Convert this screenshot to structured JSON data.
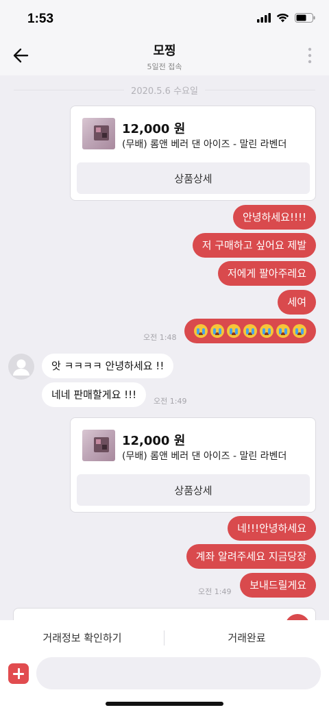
{
  "status": {
    "time": "1:53"
  },
  "header": {
    "title": "모찡",
    "subtitle": "5일전 접속"
  },
  "date_separator": "2020.5.6 수요일",
  "product": {
    "price": "12,000 원",
    "name": "(무배) 롬앤 베러 댄 아이즈 - 말린 라벤더",
    "detail_label": "상품상세"
  },
  "messages_group1": [
    "안녕하세요!!!!",
    "저 구매하고 싶어요 제발",
    "저에게 팔아주레요",
    "세여"
  ],
  "emoji_message": "😭😭😭😭😭😭😭",
  "time_1": "오전 1:48",
  "their_messages": [
    "앗 ㅋㅋㅋㅋ 안녕하세요 !!",
    "네네 판매할게요 !!!"
  ],
  "time_2": "오전 1:49",
  "messages_group2": [
    "네!!!안녕하세요",
    "계좌 알려주세요 지금당장",
    "보내드릴게요"
  ],
  "time_3": "오전 1:49",
  "bottom": {
    "trade_info_label": "거래정보 확인하기",
    "trade_complete_label": "거래완료",
    "input_placeholder": ""
  },
  "colors": {
    "accent": "#d94a4d",
    "background": "#efeef3"
  }
}
